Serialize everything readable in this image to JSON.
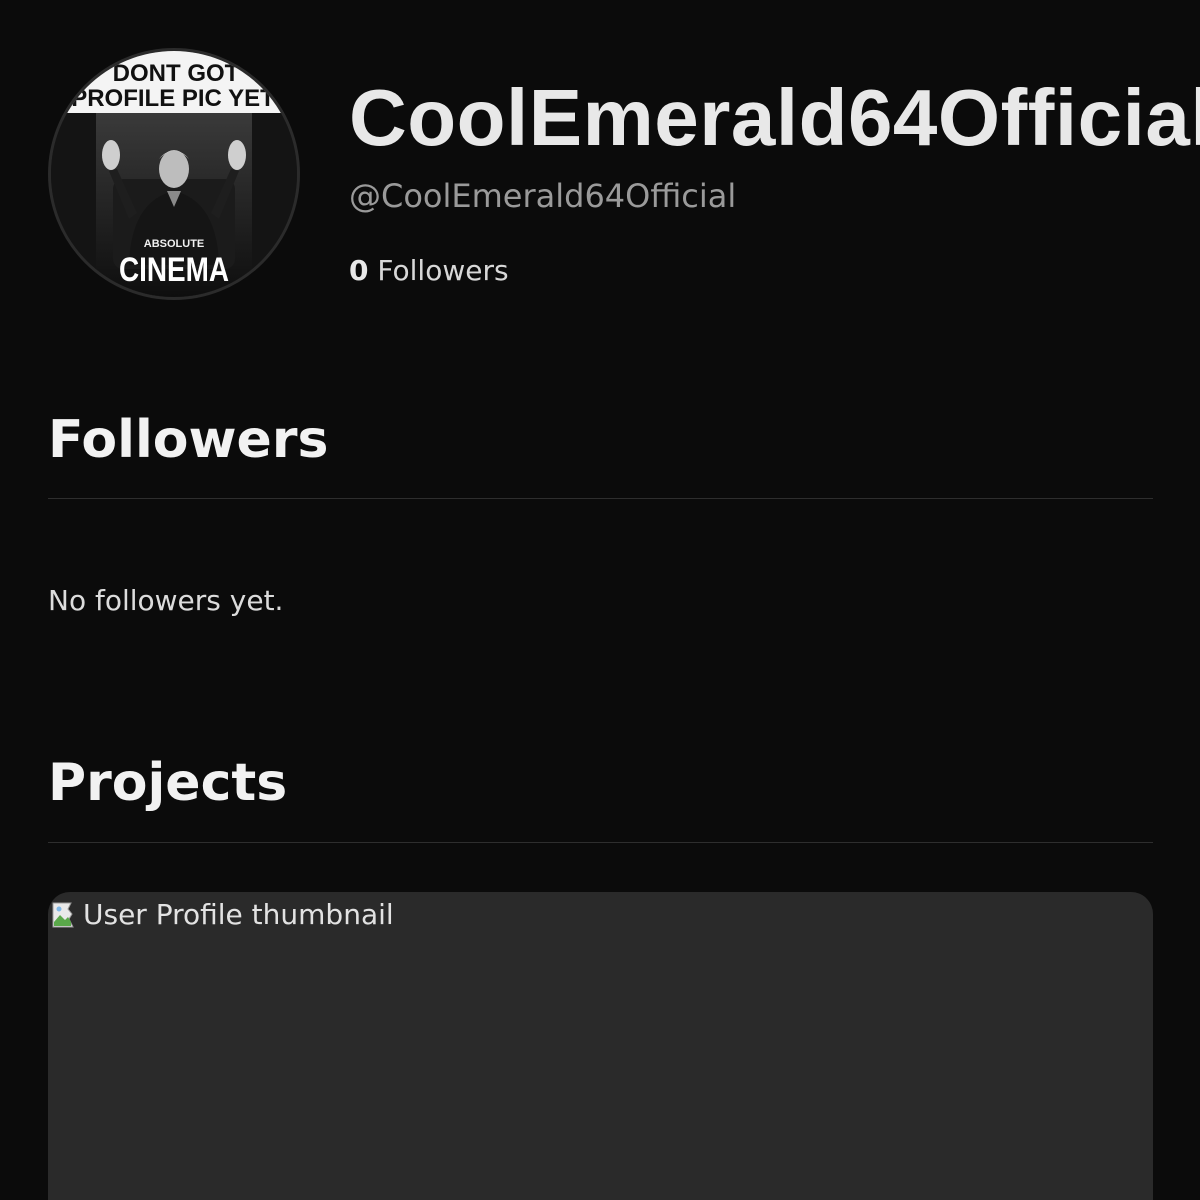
{
  "profile": {
    "display_name": "CoolEmerald64Official",
    "handle": "@CoolEmerald64Official",
    "follower_count": "0",
    "follower_label": "Followers",
    "avatar": {
      "top_text_line1": "DONT GOT",
      "top_text_line2": "PROFILE PIC YET",
      "caption_small": "ABSOLUTE",
      "caption_big": "CINEMA"
    }
  },
  "followers_section": {
    "title": "Followers",
    "empty_message": "No followers yet."
  },
  "projects_section": {
    "title": "Projects",
    "cards": [
      {
        "thumbnail_alt": "User Profile thumbnail"
      }
    ]
  },
  "colors": {
    "background": "#0b0b0b",
    "card": "#2a2a2a",
    "divider": "#2e2e2e",
    "muted_text": "#9a9a9a"
  }
}
